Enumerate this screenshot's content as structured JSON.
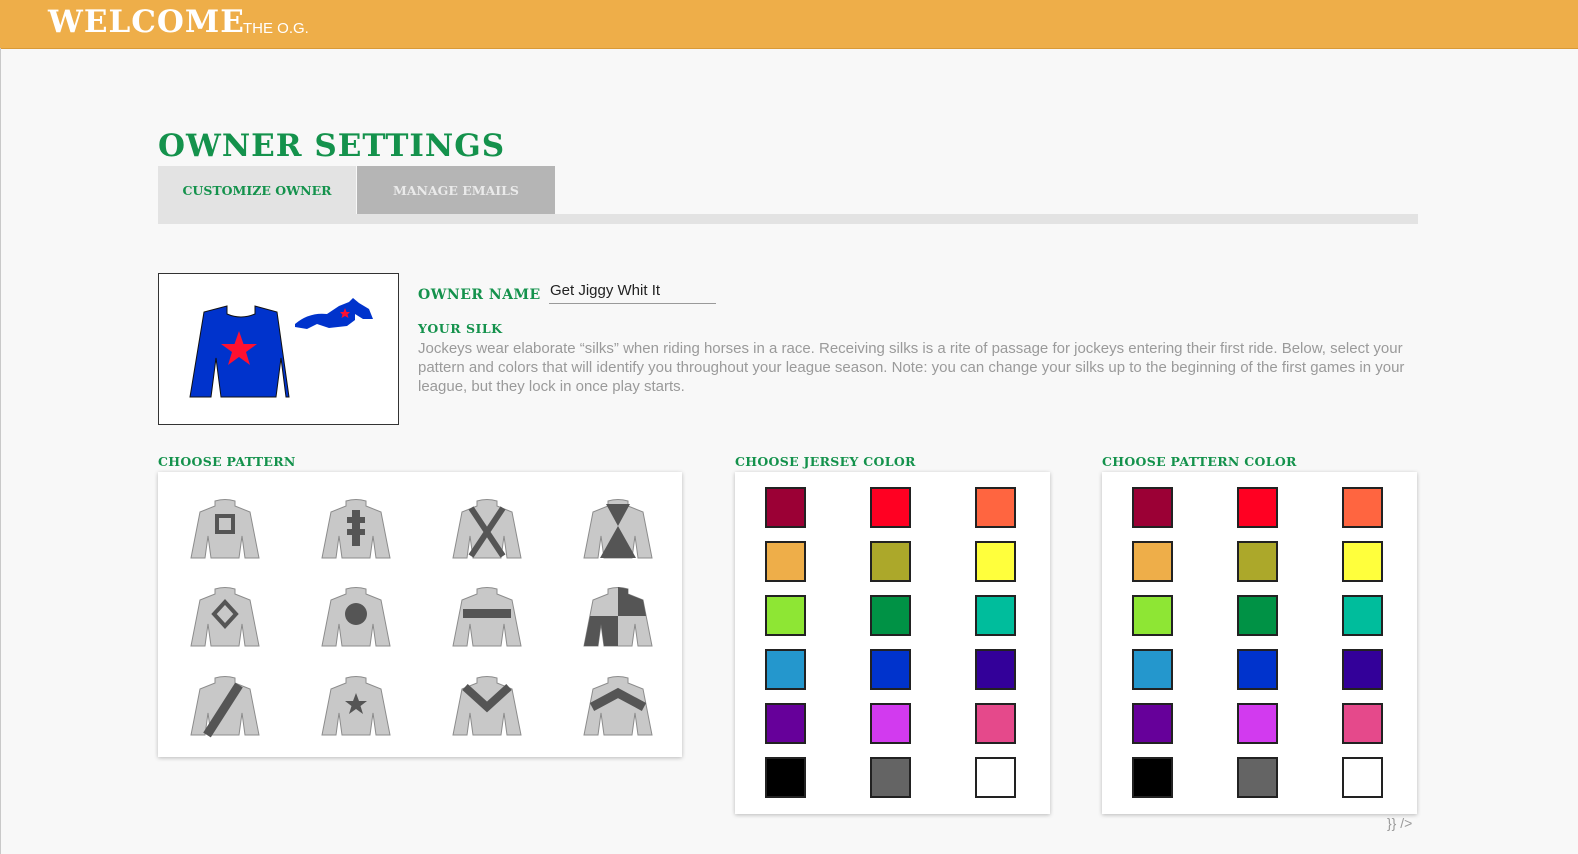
{
  "header": {
    "welcome": "WELCOME",
    "user": "THE O.G."
  },
  "page": {
    "title": "OWNER SETTINGS"
  },
  "tabs": [
    {
      "label": "CUSTOMIZE OWNER",
      "active": true
    },
    {
      "label": "MANAGE EMAILS",
      "active": false
    }
  ],
  "owner": {
    "name_label": "OWNER NAME",
    "name_value": "Get Jiggy Whit It",
    "silk_heading": "YOUR SILK",
    "silk_description": "Jockeys wear elaborate “silks” when riding horses in a race. Receiving silks is a rite of passage for jockeys entering their first ride. Below, select your pattern and colors that will identify you throughout your league season. Note: you can change your silks up to the beginning of the first games in your league, but they lock in once play starts.",
    "current_silk": {
      "jersey_color": "#0033cc",
      "pattern": "star",
      "pattern_color": "#ff1030"
    }
  },
  "patterns": {
    "label": "CHOOSE PATTERN",
    "items": [
      "square",
      "cross",
      "x-cross",
      "hourglass",
      "diamond",
      "circle",
      "band",
      "quarters",
      "sash",
      "star",
      "chevron",
      "inverted-chevron"
    ]
  },
  "jersey_colors": {
    "label": "CHOOSE JERSEY COLOR",
    "swatches": [
      "#9b0035",
      "#ff0022",
      "#ff6540",
      "#eeae49",
      "#aca82a",
      "#ffff3c",
      "#8ee634",
      "#009245",
      "#00bd9c",
      "#2497cd",
      "#0033cc",
      "#330099",
      "#66009a",
      "#d23aef",
      "#e5498b",
      "#000000",
      "#646464",
      "#ffffff"
    ]
  },
  "pattern_colors": {
    "label": "CHOOSE PATTERN COLOR",
    "swatches": [
      "#9b0035",
      "#ff0022",
      "#ff6540",
      "#eeae49",
      "#aca82a",
      "#ffff3c",
      "#8ee634",
      "#009245",
      "#00bd9c",
      "#2497cd",
      "#0033cc",
      "#330099",
      "#66009a",
      "#d23aef",
      "#e5498b",
      "#000000",
      "#646464",
      "#ffffff"
    ]
  },
  "footer": {
    "stray_text": "}} />"
  }
}
